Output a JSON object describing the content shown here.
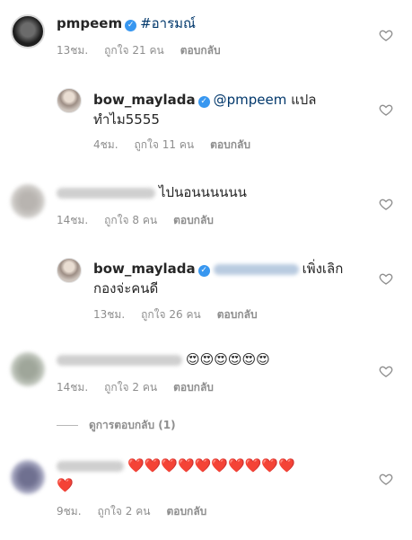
{
  "comments": [
    {
      "username": "pmpeem",
      "verified": true,
      "text": "#อารมณ์",
      "time": "13ชม.",
      "likes": "ถูกใจ 21 คน",
      "reply": "ตอบกลับ"
    },
    {
      "username": "bow_maylada",
      "verified": true,
      "mention": "@pmpeem",
      "text_line1": "แปล",
      "text_line2": "ทำไม5555",
      "time": "4ชม.",
      "likes": "ถูกใจ 11 คน",
      "reply": "ตอบกลับ"
    },
    {
      "text": "ไปนอนนนนนน",
      "time": "14ชม.",
      "likes": "ถูกใจ 8 คน",
      "reply": "ตอบกลับ"
    },
    {
      "username": "bow_maylada",
      "verified": true,
      "text_line1": "เพิ่งเลิก",
      "text_line2": "กองจ่ะคนดี",
      "time": "13ชม.",
      "likes": "ถูกใจ 26 คน",
      "reply": "ตอบกลับ"
    },
    {
      "text": "😍😍😍😍😍😍",
      "time": "14ชม.",
      "likes": "ถูกใจ 2 คน",
      "reply": "ตอบกลับ"
    },
    {
      "text_line1": "❤️❤️❤️❤️❤️❤️❤️❤️❤️❤️",
      "text_line2": "❤️",
      "time": "9ชม.",
      "likes": "ถูกใจ 2 คน",
      "reply": "ตอบกลับ"
    }
  ],
  "view_replies": "ดูการตอบกลับ (1)",
  "icons": {
    "like": "heart-outline-icon",
    "verified": "verified-badge-icon"
  },
  "colors": {
    "text": "#262626",
    "meta": "#8e8e8e",
    "mention": "#00376b",
    "verified": "#3897f0"
  }
}
